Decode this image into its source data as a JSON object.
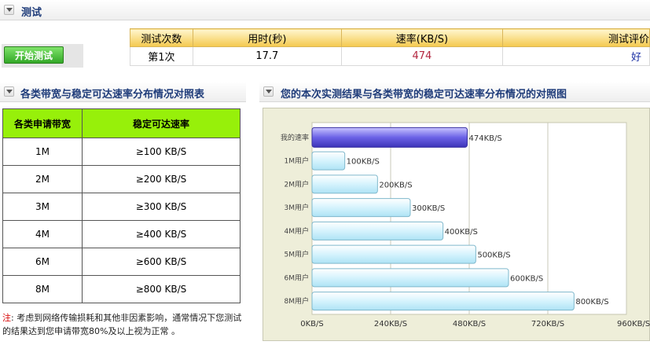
{
  "test_section": {
    "title": "测试"
  },
  "start_button": {
    "label": "开始测试"
  },
  "results_table": {
    "headers": [
      "测试次数",
      "用时(秒)",
      "速率(KB/S)",
      "测试评价"
    ],
    "row": {
      "count": "第1次",
      "time": "17.7",
      "rate": "474",
      "rating": "好"
    },
    "colors": {
      "rate": "#b3263f",
      "rating": "#1a2fa3"
    }
  },
  "bandwidth_section": {
    "title": "各类带宽与稳定可达速率分布情况对照表",
    "headers": [
      "各类申请带宽",
      "稳定可达速率"
    ],
    "rows": [
      {
        "bw": "1M",
        "rate": "≥100 KB/S"
      },
      {
        "bw": "2M",
        "rate": "≥200 KB/S"
      },
      {
        "bw": "3M",
        "rate": "≥300 KB/S"
      },
      {
        "bw": "4M",
        "rate": "≥400 KB/S"
      },
      {
        "bw": "6M",
        "rate": "≥600 KB/S"
      },
      {
        "bw": "8M",
        "rate": "≥800 KB/S"
      }
    ],
    "note_label": "注",
    "note_text": ": 考虑到网络传输损耗和其他非因素影响，通常情况下您测试的结果达到您申请带宽80%及以上视为正常 。"
  },
  "chart_section": {
    "title": "您的本次实测结果与各类带宽的稳定可达速率分布情况的对照图"
  },
  "chart_data": {
    "type": "bar",
    "orientation": "horizontal",
    "categories": [
      "我的速率",
      "1M用户",
      "2M用户",
      "3M用户",
      "4M用户",
      "5M用户",
      "6M用户",
      "8M用户"
    ],
    "values": [
      474,
      100,
      200,
      300,
      400,
      500,
      600,
      800
    ],
    "data_labels": [
      "474KB/S",
      "100KB/S",
      "200KB/S",
      "300KB/S",
      "400KB/S",
      "500KB/S",
      "600KB/S",
      "800KB/S"
    ],
    "x_ticks": [
      "0KB/S",
      "240KB/S",
      "480KB/S",
      "720KB/S",
      "960KB/S"
    ],
    "xlim": [
      0,
      960
    ],
    "grid": true,
    "colors": {
      "highlight": "#5a4fd6",
      "normal": "#cfeefb",
      "background": "#eeeed9"
    }
  }
}
